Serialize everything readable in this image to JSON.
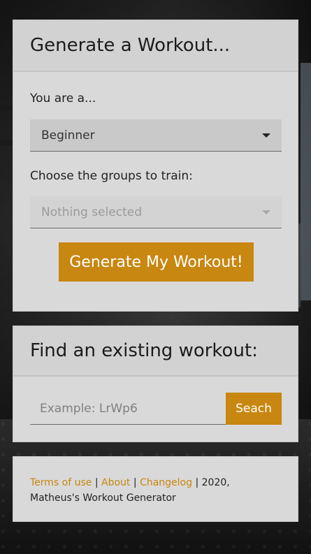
{
  "generate_card": {
    "title": "Generate a Workout...",
    "level_label": "You are a...",
    "level_selected": "Beginner",
    "groups_label": "Choose the groups to train:",
    "groups_selected": "Nothing selected",
    "generate_button": "Generate My Workout!"
  },
  "find_card": {
    "title": "Find an existing workout:",
    "search_placeholder": "Example: LrWp6",
    "search_button": "Seach"
  },
  "footer": {
    "terms": "Terms of use",
    "sep1": " | ",
    "about": "About",
    "sep2": " | ",
    "changelog": "Changelog",
    "copyright": " | 2020, Matheus's Workout Generator"
  },
  "colors": {
    "accent": "#c88710",
    "card_bg": "#d9d9d9"
  }
}
